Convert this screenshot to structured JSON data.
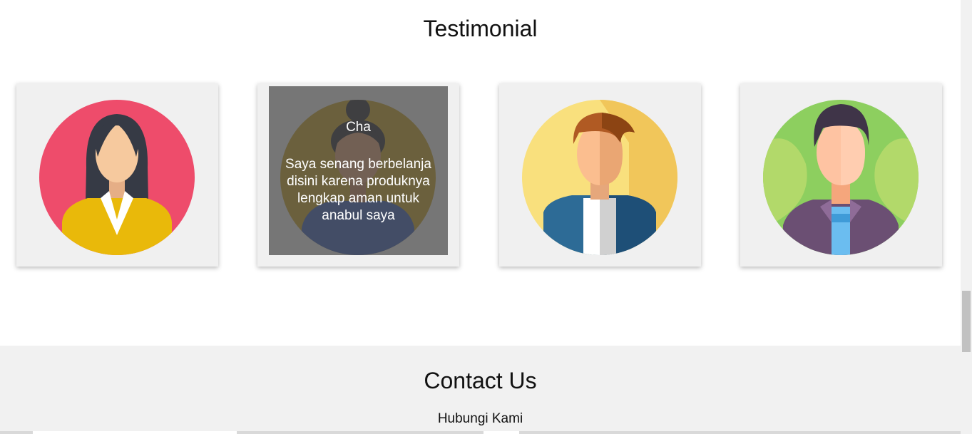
{
  "testimonial": {
    "title": "Testimonial",
    "cards": [
      {
        "avatar": "woman-black-hair-avatar-icon"
      },
      {
        "avatar": "woman-ponytail-avatar-icon",
        "hover": {
          "name": "Cha",
          "quote": "Saya senang berbelanja disini karena produknya lengkap aman untuk anabul saya"
        }
      },
      {
        "avatar": "man-brown-hair-avatar-icon"
      },
      {
        "avatar": "man-purple-jacket-avatar-icon"
      }
    ]
  },
  "contact": {
    "title": "Contact Us",
    "subtitle": "Hubungi Kami"
  },
  "colors": {
    "card_bg": "#f0f0f0",
    "contact_bg": "#f1f1f1",
    "avatar1_bg": "#ee4c6b",
    "avatar2_bg": "#c9a227",
    "avatar3_bg": "#f9e07d",
    "avatar4_bg": "#8dcf5f"
  }
}
